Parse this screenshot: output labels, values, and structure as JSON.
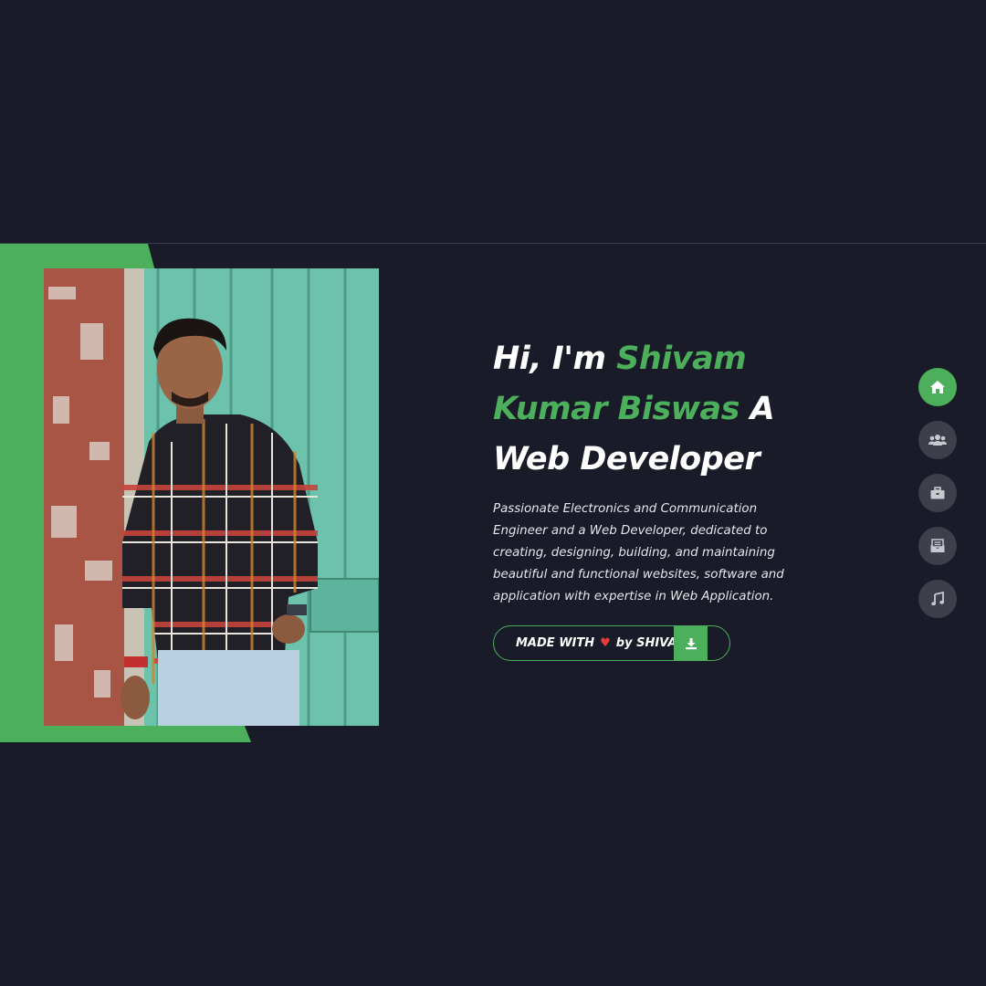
{
  "hero": {
    "greeting": "Hi, I'm",
    "name_line1": "Shivam",
    "name_line2": "Kumar Biswas",
    "role_prefix": "A",
    "role": "Web Developer",
    "description": "Passionate Electronics and Communication Engineer and a Web Developer, dedicated to creating, designing, building, and maintaining beautiful and functional websites, software and application with expertise in Web Application."
  },
  "cta": {
    "made_with": "MADE WITH",
    "heart": "♥",
    "by": "by SHIVAM",
    "icon": "download-icon"
  },
  "nav": {
    "items": [
      {
        "icon": "home-icon",
        "active": true
      },
      {
        "icon": "users-icon",
        "active": false
      },
      {
        "icon": "briefcase-icon",
        "active": false
      },
      {
        "icon": "mail-icon",
        "active": false
      },
      {
        "icon": "music-icon",
        "active": false
      }
    ]
  },
  "colors": {
    "background": "#191b28",
    "accent": "#4caf5b",
    "nav_inactive": "#3d3f4a",
    "heart": "#e53b3b"
  }
}
